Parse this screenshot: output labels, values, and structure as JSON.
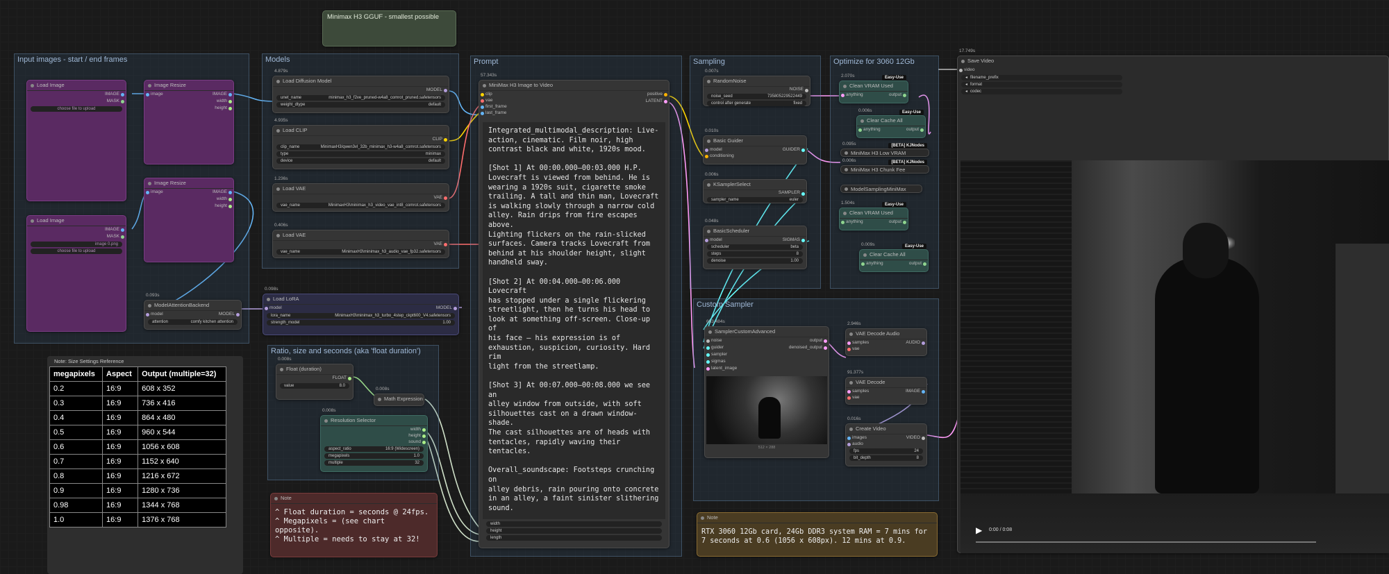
{
  "top_note": {
    "label": "Minimax H3 GGUF - smallest possible"
  },
  "groups": {
    "input_images": "Input images - start / end frames",
    "models": "Models",
    "prompt": "Prompt",
    "sampling": "Sampling",
    "optimize": "Optimize for 3060 12Gb",
    "ratio": "Ratio, size and seconds (aka 'float duration')",
    "custom_sampler": "Custom Sampler"
  },
  "nodes": {
    "load_diffusion": {
      "timer": "4.879s",
      "title": "Load Diffusion Model",
      "out": "MODEL",
      "w1_label": "unet_name",
      "w1_val": "minimax_h3_f2ve_pruned-w4a8_comrot_pruned.safetensors",
      "w2_label": "weight_dtype",
      "w2_val": "default"
    },
    "load_clip": {
      "timer": "4.935s",
      "title": "Load CLIP",
      "out": "CLIP",
      "w1_label": "clip_name",
      "w1_val": "MinimaxH3/qwen3vl_32b_minimax_h3-w4a8_comrot.safetensors",
      "w2_label": "type",
      "w2_val": "minimax",
      "w3_label": "device",
      "w3_val": "default"
    },
    "load_vae_1": {
      "timer": "1.236s",
      "title": "Load VAE",
      "out": "VAE",
      "w1_label": "vae_name",
      "w1_val": "MinimaxH3\\minimax_h3_video_vae_int8_comrot.safetensors"
    },
    "load_vae_2": {
      "timer": "0.406s",
      "title": "Load VAE",
      "out": "VAE",
      "w1_label": "vae_name",
      "w1_val": "MinimaxH3\\minimax_h3_audio_vae_fp32.safetensors"
    },
    "load_lora": {
      "timer": "0.098s",
      "title": "Load LoRA",
      "in": "model",
      "out": "MODEL",
      "w1_label": "lora_name",
      "w1_val": "MinimaxH3\\minimax_h3_turbo_4step_ckpt600_V4.safetensors",
      "w2_label": "strength_model",
      "w2_val": "1.00"
    },
    "attention": {
      "timer": "0.093s",
      "title": "ModelAttentionBackend",
      "in": "model",
      "out": "MODEL",
      "w1_label": "attention",
      "w1_val": "comfy kitchen attention"
    },
    "load_image_1": {
      "title": "Load Image",
      "out1": "IMAGE",
      "out2": "MASK",
      "hint": "choose file to upload"
    },
    "load_image_2": {
      "title": "Load Image",
      "out1": "IMAGE",
      "out2": "MASK",
      "hint": "choose file to upload",
      "w1_val": "image 0.png"
    },
    "resize_1": {
      "title": "Image Resize",
      "in": "image",
      "out1": "IMAGE",
      "out2": "width",
      "out3": "height"
    },
    "resize_2": {
      "title": "Image Resize",
      "in": "image",
      "out1": "IMAGE",
      "out2": "width",
      "out3": "height"
    },
    "prompt_node": {
      "timer": "57.343s",
      "title": "MiniMax H3 Image to Video",
      "in1": "clip",
      "in2": "vae",
      "in3": "first_frame",
      "in4": "last_frame",
      "out1": "positive",
      "out2": "LATENT",
      "b1": "width",
      "b2": "height",
      "b3": "length"
    },
    "random_noise": {
      "timer": "0.007s",
      "title": "RandomNoise",
      "out": "NOISE",
      "w1_label": "noise_seed",
      "w1_val": "735805229522449",
      "w2_label": "control after generate",
      "w2_val": "fixed"
    },
    "basic_guider": {
      "timer": "0.010s",
      "title": "Basic Guider",
      "in1": "model",
      "in2": "conditioning",
      "out": "GUIDER"
    },
    "ksampler_select": {
      "timer": "0.006s",
      "title": "KSamplerSelect",
      "out": "SAMPLER",
      "w1_label": "sampler_name",
      "w1_val": "euler"
    },
    "basic_scheduler": {
      "timer": "0.048s",
      "title": "BasicScheduler",
      "in": "model",
      "out": "SIGMAS",
      "w1_label": "scheduler",
      "w1_val": "beta",
      "w2_label": "steps",
      "w2_val": "8",
      "w3_label": "denoise",
      "w3_val": "1.00"
    },
    "sampler_custom": {
      "timer": "663.484s",
      "title": "SamplerCustomAdvanced",
      "in1": "noise",
      "in2": "guider",
      "in3": "sampler",
      "in4": "sigmas",
      "in5": "latent_image",
      "out1": "output",
      "out2": "denoised_output",
      "caption": "512 × 288"
    },
    "clean_vram_1": {
      "timer": "2.070s",
      "title": "Clean VRAM Used",
      "badge": "Easy-Use",
      "in": "anything",
      "out": "output"
    },
    "clear_cache_1": {
      "timer": "0.006s",
      "title": "Clear Cache All",
      "badge": "Easy-Use",
      "in": "anything",
      "out": "output"
    },
    "low_vram": {
      "timer": "0.095s",
      "title": "MiniMax H3 Low VRAM",
      "badge": "[BETA] KJNodes"
    },
    "chunk_fee": {
      "timer": "0.006s",
      "title": "MiniMax H3 Chunk Fee",
      "badge": "[BETA] KJNodes"
    },
    "model_sampling": {
      "title": "ModelSamplingMiniMax"
    },
    "clean_vram_2": {
      "timer": "1.504s",
      "title": "Clean VRAM Used",
      "badge": "Easy-Use",
      "in": "anything",
      "out": "output"
    },
    "clear_cache_2": {
      "timer": "0.009s",
      "title": "Clear Cache All",
      "badge": "Easy-Use",
      "in": "anything",
      "out": "output"
    },
    "vae_decode_audio": {
      "timer": "2.946s",
      "title": "VAE Decode Audio",
      "in1": "samples",
      "in2": "vae",
      "out": "AUDIO"
    },
    "vae_decode": {
      "timer": "91.377s",
      "title": "VAE Decode",
      "in1": "samples",
      "in2": "vae",
      "out": "IMAGE"
    },
    "create_video": {
      "timer": "0.016s",
      "title": "Create Video",
      "in1": "images",
      "in2": "audio",
      "out": "VIDEO",
      "w1_label": "fps",
      "w1_val": "24",
      "w2_label": "bit_depth",
      "w2_val": "8"
    },
    "float_duration": {
      "timer": "0.008s",
      "title": "Float (duration)",
      "out": "FLOAT",
      "w1_label": "value",
      "w1_val": "8.0"
    },
    "math_expr": {
      "timer": "0.008s",
      "title": "Math Expression"
    },
    "resolution": {
      "timer": "0.008s",
      "title": "Resolution Selector",
      "out1": "width",
      "out2": "height",
      "out3": "sound",
      "w1_label": "aspect_ratio",
      "w1_val": "16:9 (Widescreen)",
      "w2_label": "megapixels",
      "w2_val": "1.0",
      "w3_label": "multiple",
      "w3_val": "32"
    },
    "save_video": {
      "timer": "17.749s",
      "title": "Save Video",
      "in": "video",
      "w1": "filename_prefix",
      "w2": "format",
      "w3": "codec",
      "time": "0:00 / 0:08"
    }
  },
  "prompt_text": "Integrated_multimodal_description: Live-\naction, cinematic. Film noir, high\ncontrast black and white, 1920s mood.\n\n[Shot 1] At 00:00.000–00:03.000 H.P.\nLovecraft is viewed from behind. He is\nwearing a 1920s suit, cigarette smoke\ntrailing. A tall and thin man, Lovecraft\nis walking slowly through a narrow cold\nalley. Rain drips from fire escapes above.\nLighting flickers on the rain-slicked\nsurfaces. Camera tracks Lovecraft from\nbehind at his shoulder height, slight\nhandheld sway.\n\n[Shot 2] At 00:04.000–00:06.000 Lovecraft\nhas stopped under a single flickering\nstreetlight, then he turns his head to\nlook at something off-screen. Close-up of\nhis face — his expression is of\nexhaustion, suspicion, curiosity. Hard rim\nlight from the streetlamp.\n\n[Shot 3] At 00:07.000–00:08.000 we see an\nalley window from outside, with soft\nsilhouettes cast on a drawn window-shade.\nThe cast silhouettes are of heads with\ntentacles, rapidly waving their tentacles.\n\nOverall_soundscape: Footsteps crunching on\nalley debris, rain pouring onto concrete\nin an alley, a faint sinister slithering\nsound.\n\nNon_diegetic_music: Sustained cello notes\nat a slow tempo with widely spaced piano\ntones, gradually decreasing in volume.",
  "size_table": {
    "title": "Note: Size Settings Reference",
    "headers": [
      "megapixels",
      "Aspect",
      "Output (multiple=32)"
    ],
    "rows": [
      [
        "0.2",
        "16:9",
        "608 x 352"
      ],
      [
        "0.3",
        "16:9",
        "736 x 416"
      ],
      [
        "0.4",
        "16:9",
        "864 x 480"
      ],
      [
        "0.5",
        "16:9",
        "960 x 544"
      ],
      [
        "0.6",
        "16:9",
        "1056 x 608"
      ],
      [
        "0.7",
        "16:9",
        "1152 x 640"
      ],
      [
        "0.8",
        "16:9",
        "1216 x 672"
      ],
      [
        "0.9",
        "16:9",
        "1280 x 736"
      ],
      [
        "0.98",
        "16:9",
        "1344 x 768"
      ],
      [
        "1.0",
        "16:9",
        "1376 x 768"
      ]
    ]
  },
  "note_red": {
    "title": "Note",
    "text": "^ Float duration = seconds @ 24fps.\n^ Megapixels = (see chart opposite).\n^ Multiple = needs to stay at 32!"
  },
  "note_gold": {
    "title": "Note",
    "text": "RTX 3060 12Gb card, 24Gb DDR3 system RAM = 7 mins for\n7 seconds at 0.6 (1056 x 608px). 12 mins at 0.9."
  },
  "colors": {
    "model": "#b39ddb",
    "clip": "#ffd500",
    "vae": "#ff6e6e",
    "image": "#64b5f6",
    "latent": "#ff9cf9",
    "float": "#aaee88",
    "guider": "#66ffff"
  }
}
